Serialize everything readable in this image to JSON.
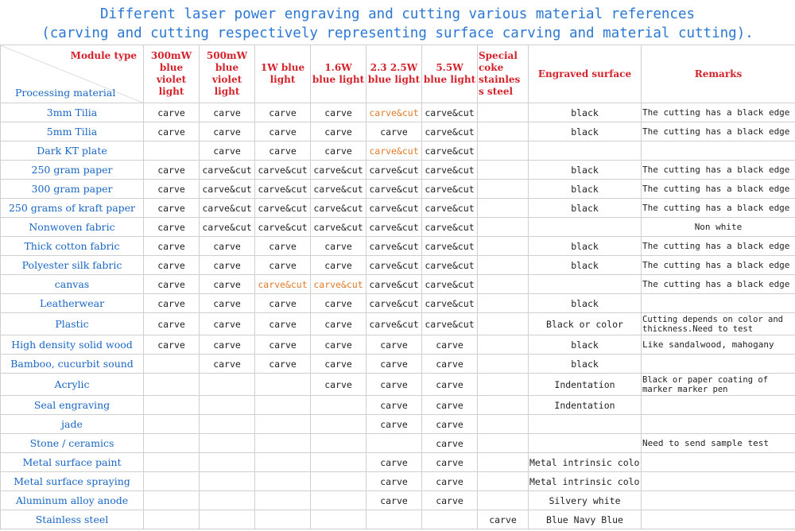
{
  "title": {
    "line1": "Different laser power engraving and cutting various material references",
    "line2": "(carving and cutting respectively representing surface carving and material cutting)."
  },
  "header": {
    "module_type": "Module type",
    "processing_material": "Processing material",
    "columns": [
      "300mW blue violet light",
      "500mW blue violet light",
      "1W blue light",
      "1.6W blue light",
      "2.3 2.5W blue light",
      "5.5W blue light",
      "Special coke stainles s steel",
      "Engraved surface",
      "Remarks"
    ]
  },
  "colors": {
    "title": "#2b77d4",
    "header": "#d4232b",
    "material": "#1a66c4",
    "highlight": "#e07b2a"
  },
  "rows": [
    {
      "material": "3mm Tilia",
      "cells": [
        "carve",
        "carve",
        "carve",
        "carve",
        "carve&cut",
        "carve&cut",
        "",
        "black",
        "The cutting has a black edge"
      ],
      "hl": [
        4
      ]
    },
    {
      "material": "5mm Tilia",
      "cells": [
        "carve",
        "carve",
        "carve",
        "carve",
        "carve",
        "carve&cut",
        "",
        "black",
        "The cutting has a black edge"
      ],
      "hl": []
    },
    {
      "material": "Dark KT plate",
      "cells": [
        "",
        "carve",
        "carve",
        "carve",
        "carve&cut",
        "carve&cut",
        "",
        "",
        ""
      ],
      "hl": [
        4
      ]
    },
    {
      "material": "250 gram paper",
      "cells": [
        "carve",
        "carve&cut",
        "carve&cut",
        "carve&cut",
        "carve&cut",
        "carve&cut",
        "",
        "black",
        "The cutting has a black edge"
      ],
      "hl": []
    },
    {
      "material": "300 gram paper",
      "cells": [
        "carve",
        "carve&cut",
        "carve&cut",
        "carve&cut",
        "carve&cut",
        "carve&cut",
        "",
        "black",
        "The cutting has a black edge"
      ],
      "hl": []
    },
    {
      "material": "250 grams of kraft paper",
      "cells": [
        "carve",
        "carve&cut",
        "carve&cut",
        "carve&cut",
        "carve&cut",
        "carve&cut",
        "",
        "black",
        "The cutting has a black edge"
      ],
      "hl": []
    },
    {
      "material": "Nonwoven fabric",
      "cells": [
        "carve",
        "carve&cut",
        "carve&cut",
        "carve&cut",
        "carve&cut",
        "carve&cut",
        "",
        "",
        "Non white"
      ],
      "hl": [],
      "remCenter": true
    },
    {
      "material": "Thick cotton fabric",
      "cells": [
        "carve",
        "carve",
        "carve",
        "carve",
        "carve&cut",
        "carve&cut",
        "",
        "black",
        "The cutting has a black edge"
      ],
      "hl": []
    },
    {
      "material": "Polyester silk fabric",
      "cells": [
        "carve",
        "carve",
        "carve",
        "carve",
        "carve&cut",
        "carve&cut",
        "",
        "black",
        "The cutting has a black edge"
      ],
      "hl": []
    },
    {
      "material": "canvas",
      "cells": [
        "carve",
        "carve",
        "carve&cut",
        "carve&cut",
        "carve&cut",
        "carve&cut",
        "",
        "",
        "The cutting has a black edge"
      ],
      "hl": [
        2,
        3
      ]
    },
    {
      "material": "Leatherwear",
      "cells": [
        "carve",
        "carve",
        "carve",
        "carve",
        "carve&cut",
        "carve&cut",
        "",
        "black",
        ""
      ],
      "hl": []
    },
    {
      "material": "Plastic",
      "cells": [
        "carve",
        "carve",
        "carve",
        "carve",
        "carve&cut",
        "carve&cut",
        "",
        "Black or color",
        "Cutting depends on color and thickness.Need to test"
      ],
      "hl": [],
      "tall": true
    },
    {
      "material": "High density solid wood",
      "cells": [
        "carve",
        "carve",
        "carve",
        "carve",
        "carve",
        "carve",
        "",
        "black",
        "Like sandalwood, mahogany"
      ],
      "hl": []
    },
    {
      "material": "Bamboo, cucurbit sound",
      "cells": [
        "",
        "carve",
        "carve",
        "carve",
        "carve",
        "carve",
        "",
        "black",
        ""
      ],
      "hl": []
    },
    {
      "material": "Acrylic",
      "cells": [
        "",
        "",
        "",
        "carve",
        "carve",
        "carve",
        "",
        "Indentation",
        "Black or paper coating of marker marker pen"
      ],
      "hl": [],
      "tall": true
    },
    {
      "material": "Seal engraving",
      "cells": [
        "",
        "",
        "",
        "",
        "carve",
        "carve",
        "",
        "Indentation",
        ""
      ],
      "hl": []
    },
    {
      "material": "jade",
      "cells": [
        "",
        "",
        "",
        "",
        "carve",
        "carve",
        "",
        "",
        ""
      ],
      "hl": []
    },
    {
      "material": "Stone / ceramics",
      "cells": [
        "",
        "",
        "",
        "",
        "",
        "carve",
        "",
        "",
        "Need to send sample test"
      ],
      "hl": []
    },
    {
      "material": "Metal surface paint",
      "cells": [
        "",
        "",
        "",
        "",
        "carve",
        "carve",
        "",
        "Metal intrinsic color",
        ""
      ],
      "hl": []
    },
    {
      "material": "Metal surface spraying",
      "cells": [
        "",
        "",
        "",
        "",
        "carve",
        "carve",
        "",
        "Metal intrinsic color",
        ""
      ],
      "hl": []
    },
    {
      "material": "Aluminum alloy anode",
      "cells": [
        "",
        "",
        "",
        "",
        "carve",
        "carve",
        "",
        "Silvery white",
        ""
      ],
      "hl": []
    },
    {
      "material": "Stainless steel",
      "cells": [
        "",
        "",
        "",
        "",
        "",
        "",
        "carve",
        "Blue Navy Blue",
        ""
      ],
      "hl": []
    }
  ]
}
